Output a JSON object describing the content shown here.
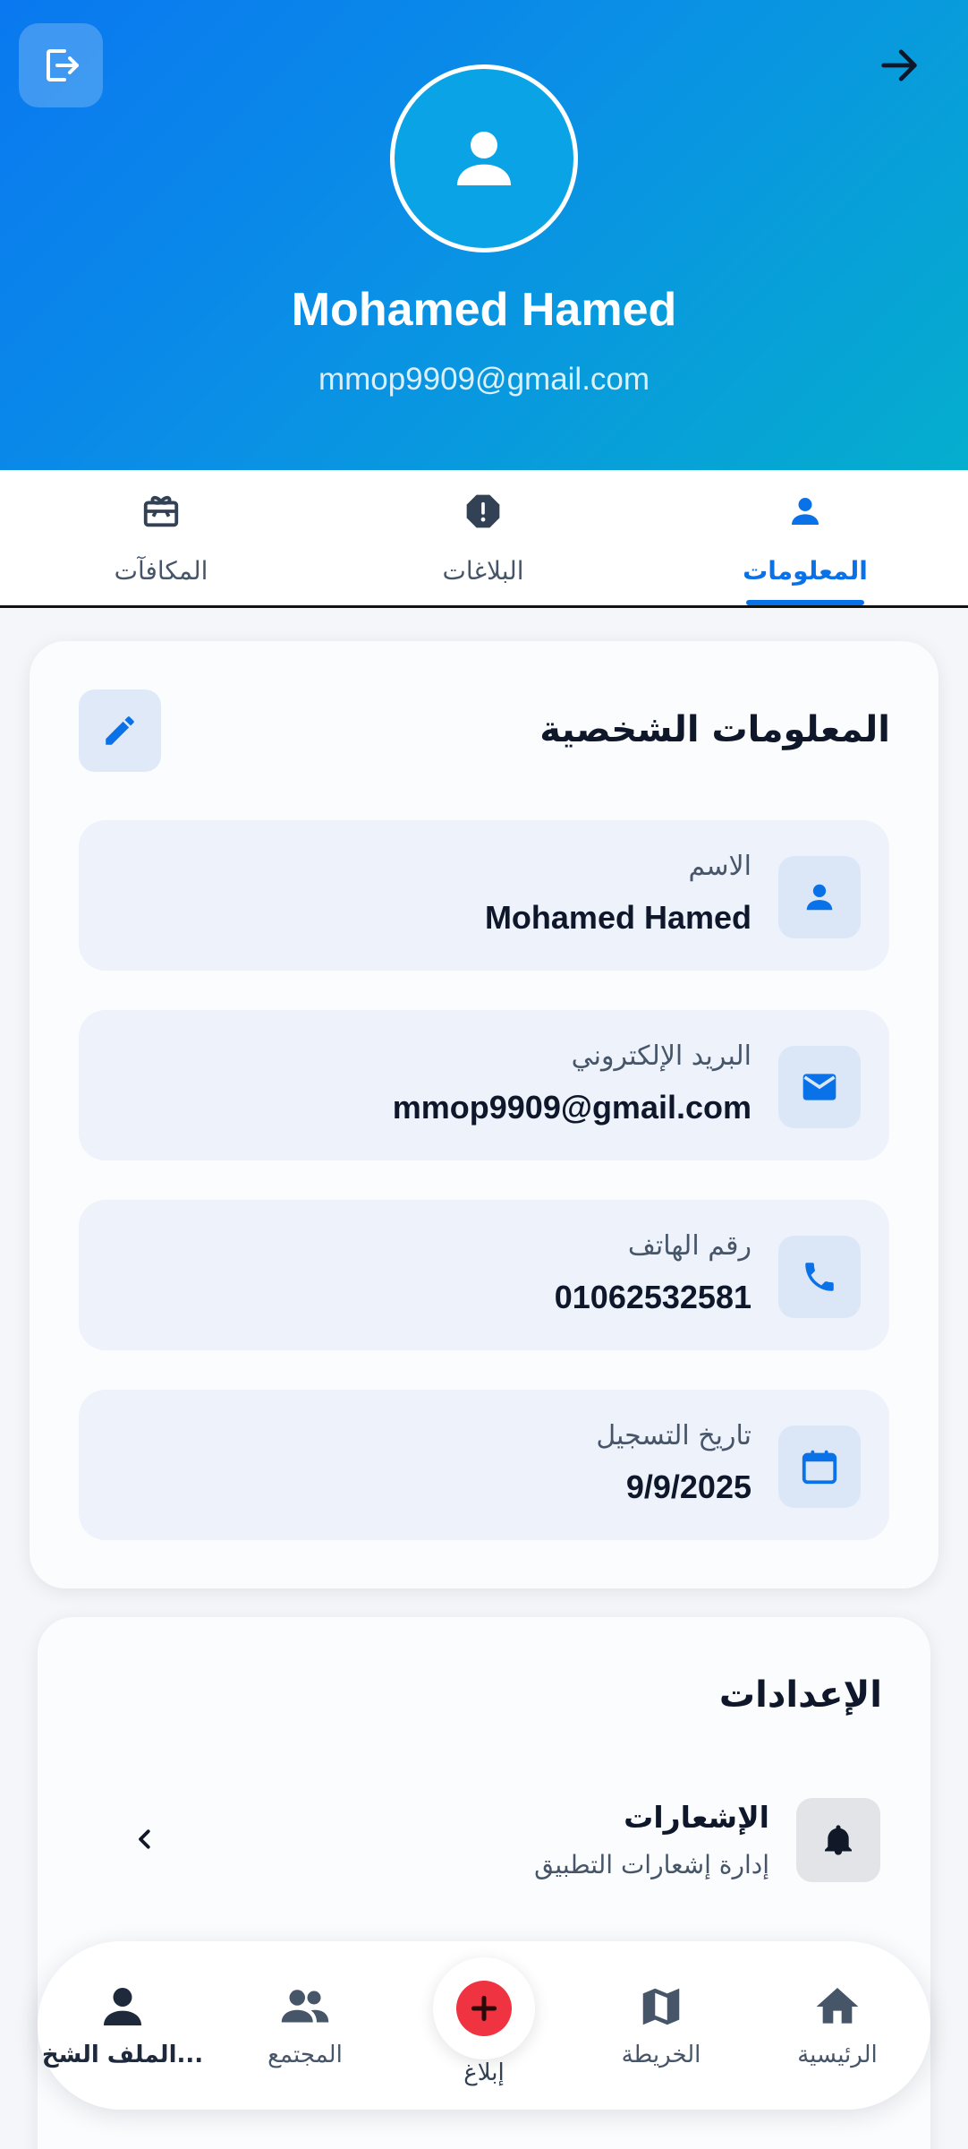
{
  "header": {
    "name": "Mohamed Hamed",
    "email": "mmop9909@gmail.com",
    "logout_icon": "logout-icon",
    "back_icon": "arrow-right-icon",
    "avatar_icon": "person-icon"
  },
  "tabs": [
    {
      "label": "المعلومات",
      "icon": "person-icon",
      "active": true
    },
    {
      "label": "البلاغات",
      "icon": "alert-octagon-icon",
      "active": false
    },
    {
      "label": "المكافآت",
      "icon": "gift-card-icon",
      "active": false
    }
  ],
  "info": {
    "title": "المعلومات الشخصية",
    "fields": [
      {
        "label": "الاسم",
        "value": "Mohamed Hamed",
        "icon": "person-icon"
      },
      {
        "label": "البريد الإلكتروني",
        "value": "mmop9909@gmail.com",
        "icon": "mail-icon"
      },
      {
        "label": "رقم الهاتف",
        "value": "01062532581",
        "icon": "phone-icon"
      },
      {
        "label": "تاريخ التسجيل",
        "value": "9/9/2025",
        "icon": "calendar-icon"
      }
    ]
  },
  "settings": {
    "title": "الإعدادات",
    "items": [
      {
        "title": "الإشعارات",
        "subtitle": "إدارة إشعارات التطبيق",
        "icon": "bell-icon"
      }
    ]
  },
  "bottom_nav": {
    "items": [
      {
        "label": "الرئيسية",
        "icon": "home-icon"
      },
      {
        "label": "الخريطة",
        "icon": "map-icon"
      },
      {
        "label": "إبلاغ",
        "icon": "plus-icon"
      },
      {
        "label": "المجتمع",
        "icon": "group-icon"
      },
      {
        "label": "الملف الشخ...",
        "icon": "person-icon",
        "active": true
      }
    ]
  },
  "colors": {
    "primary": "#0a72e8",
    "gradient_start": "#0a78f0",
    "gradient_end": "#05aecd",
    "report_button": "#ef3340"
  }
}
